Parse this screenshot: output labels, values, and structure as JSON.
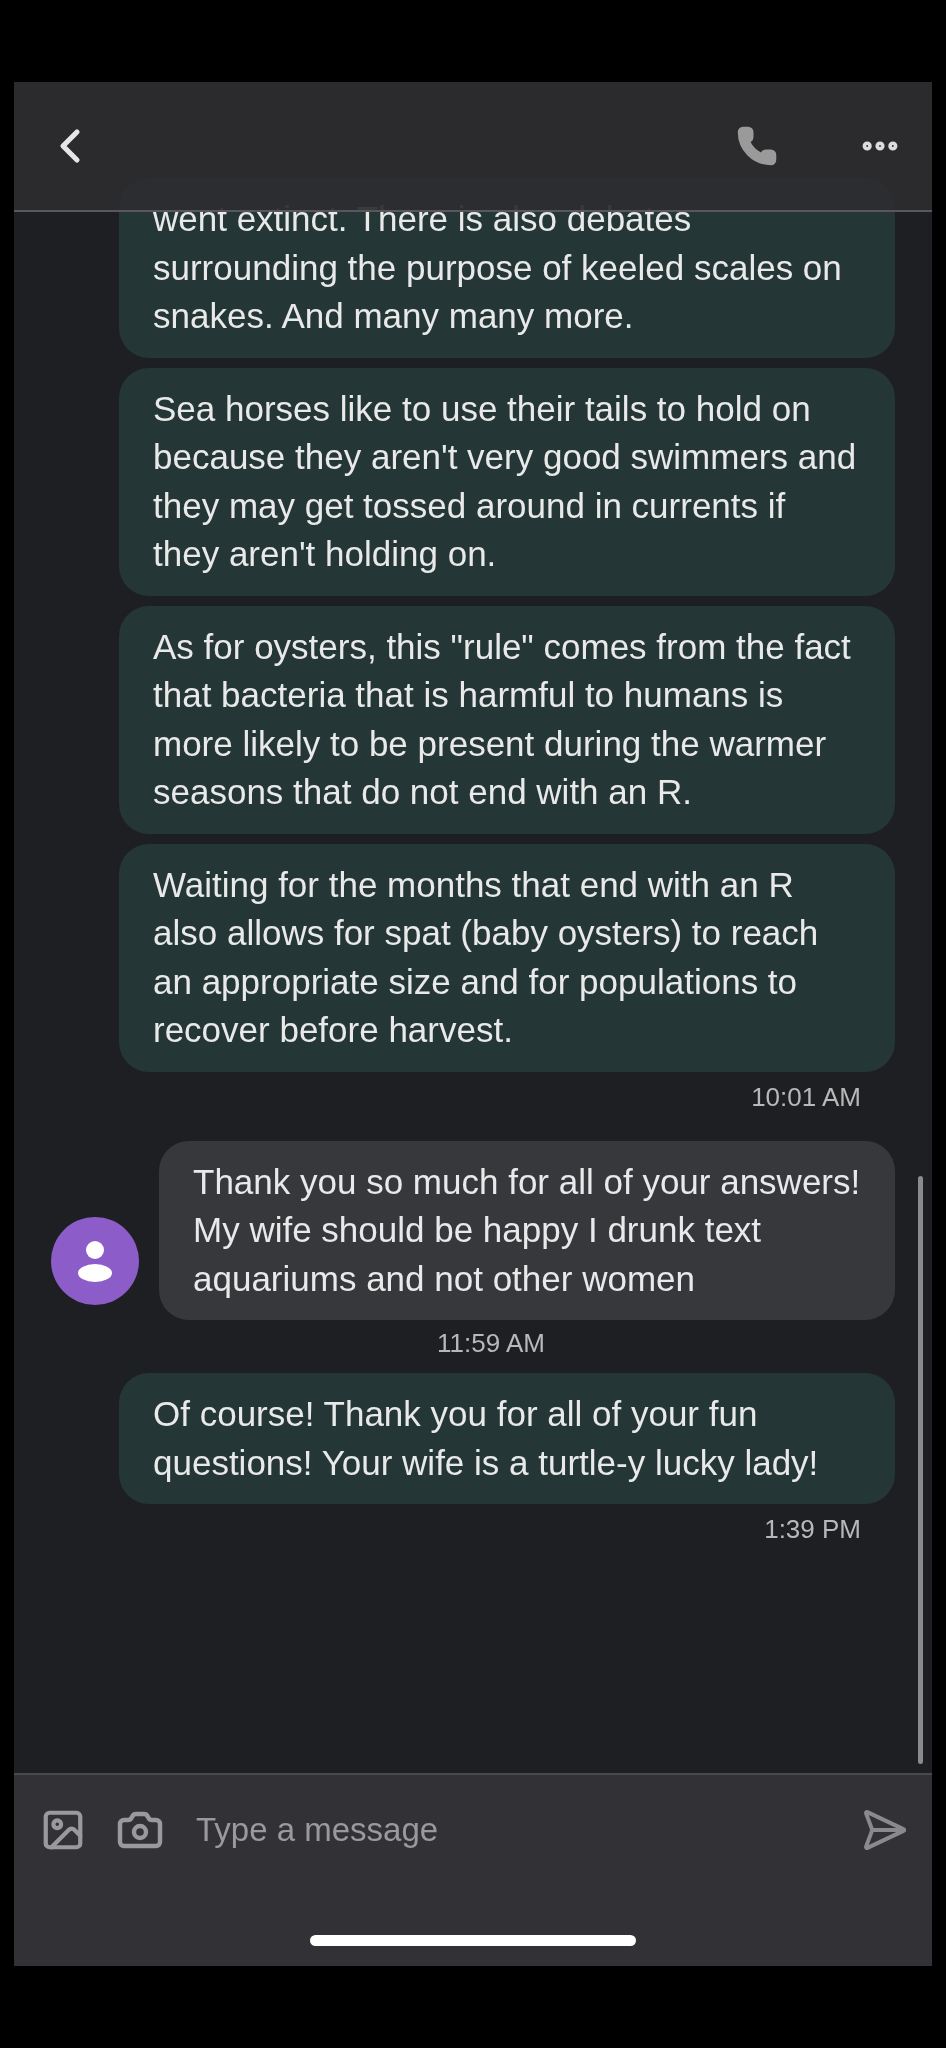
{
  "messages": [
    {
      "kind": "sent",
      "text": "went extinct. There is also debates surrounding the purpose of keeled scales on snakes. And many many more."
    },
    {
      "kind": "sent",
      "text": "Sea horses like to use their tails to hold on because they aren't very good swimmers and they may get tossed around in currents if they aren't holding on."
    },
    {
      "kind": "sent",
      "text": "As for oysters, this \"rule\" comes from the fact that bacteria that is harmful to humans is more likely to be present during the warmer seasons that do not end with an R."
    },
    {
      "kind": "sent",
      "text": "Waiting for the months that end with an R also allows for spat (baby oysters) to reach an appropriate size and for populations to recover before harvest.",
      "time": "10:01 AM"
    },
    {
      "kind": "received",
      "text": "Thank you so much for all of your answers! My wife should be happy I drunk text aquariums and not other women",
      "time": "11:59 AM"
    },
    {
      "kind": "sent",
      "text": "Of course! Thank you for all of your fun questions! Your wife is a turtle-y lucky lady!",
      "time": "1:39 PM"
    }
  ],
  "composer": {
    "placeholder": "Type a message"
  }
}
